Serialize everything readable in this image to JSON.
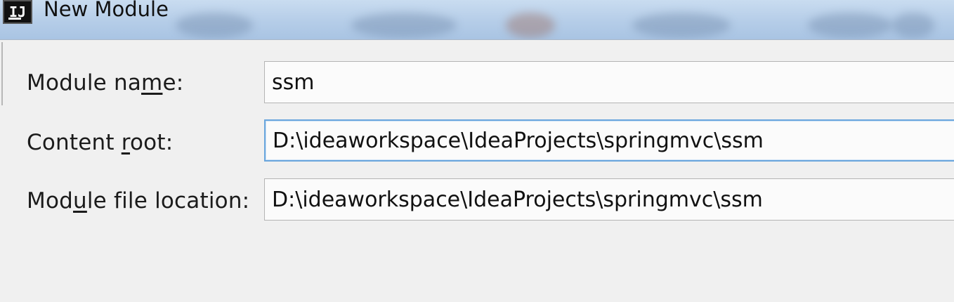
{
  "window": {
    "title": "New Module",
    "icon_text": "IJ",
    "icon_name": "intellij-app-icon"
  },
  "form": {
    "module_name": {
      "label_pre": "Module na",
      "label_mnemonic": "m",
      "label_post": "e:",
      "value": "ssm"
    },
    "content_root": {
      "label_pre": "Content ",
      "label_mnemonic": "r",
      "label_post": "oot:",
      "value": "D:\\ideaworkspace\\IdeaProjects\\springmvc\\ssm"
    },
    "module_file_location": {
      "label_pre": "Mod",
      "label_mnemonic": "u",
      "label_post": "le file location:",
      "value": "D:\\ideaworkspace\\IdeaProjects\\springmvc\\ssm"
    }
  },
  "colors": {
    "titlebar": "#b5cde8",
    "dialog_bg": "#f0f0f0",
    "focus_border": "#6aa6dd"
  }
}
